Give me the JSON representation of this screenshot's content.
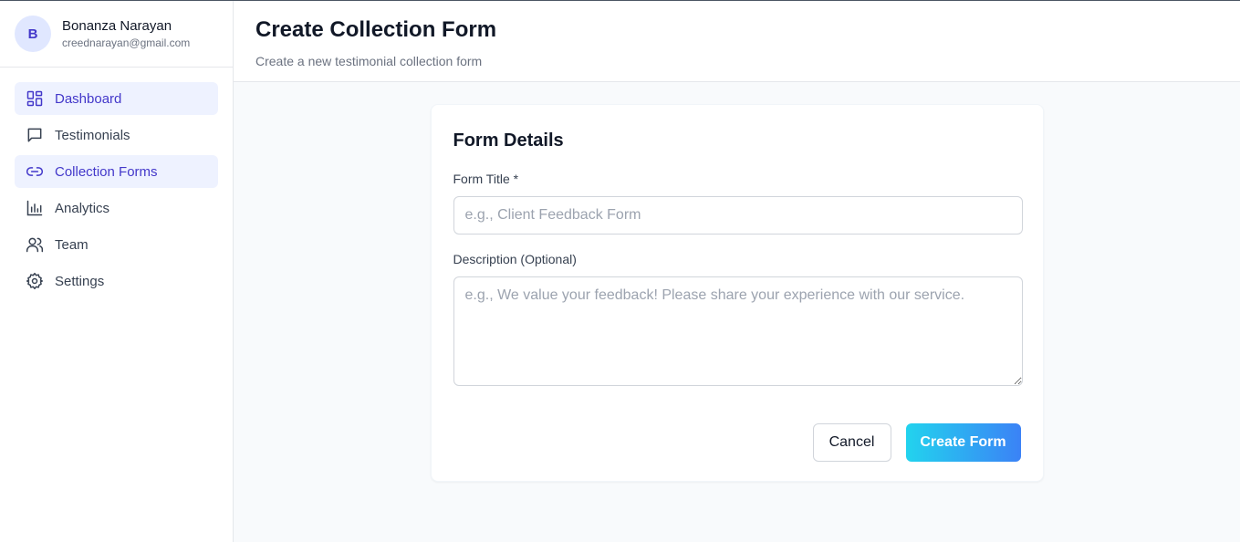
{
  "user": {
    "initial": "B",
    "name": "Bonanza Narayan",
    "email": "creednarayan@gmail.com"
  },
  "sidebar": {
    "items": [
      {
        "label": "Dashboard",
        "icon": "dashboard-icon",
        "active": true
      },
      {
        "label": "Testimonials",
        "icon": "message-icon",
        "active": false
      },
      {
        "label": "Collection Forms",
        "icon": "link-icon",
        "active": true
      },
      {
        "label": "Analytics",
        "icon": "bar-chart-icon",
        "active": false
      },
      {
        "label": "Team",
        "icon": "users-icon",
        "active": false
      },
      {
        "label": "Settings",
        "icon": "gear-icon",
        "active": false
      }
    ]
  },
  "header": {
    "title": "Create Collection Form",
    "subtitle": "Create a new testimonial collection form"
  },
  "form": {
    "card_title": "Form Details",
    "title_label": "Form Title *",
    "title_value": "",
    "title_placeholder": "e.g., Client Feedback Form",
    "description_label": "Description (Optional)",
    "description_value": "",
    "description_placeholder": "e.g., We value your feedback! Please share your experience with our service.",
    "cancel_label": "Cancel",
    "submit_label": "Create Form"
  },
  "colors": {
    "accent": "#4338ca",
    "active_bg": "#eef2ff",
    "gradient_start": "#22d3ee",
    "gradient_end": "#3b82f6"
  }
}
